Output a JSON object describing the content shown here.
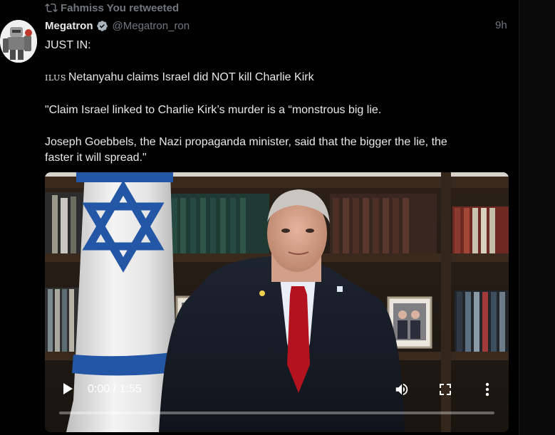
{
  "retweet": {
    "icon": "retweet-icon",
    "text": "Fahmiss You retweeted"
  },
  "author": {
    "display_name": "Megatron",
    "verified": true,
    "handle": "@Megatron_ron",
    "avatar": "robot-avatar"
  },
  "timestamp": "9h",
  "tweet": {
    "line1": "JUST IN:",
    "line2_flag": "ILUS",
    "line2_text": "Netanyahu claims Israel did NOT kill Charlie Kirk",
    "line3": "\"Claim Israel linked to Charlie Kirk’s murder is a “monstrous big lie.",
    "line4": "Joseph Goebbels, the Nazi propaganda minister, said that the bigger the lie, the",
    "line5": "faster it will spread.\""
  },
  "video": {
    "time_display": "0:00 / 1:55",
    "progress": 0.0,
    "controls": {
      "play": "play-icon",
      "volume": "volume-icon",
      "fullscreen": "fullscreen-icon",
      "more": "more-vertical-icon"
    }
  },
  "colors": {
    "background": "#000000",
    "text": "#e7e9ea",
    "muted": "#71767b",
    "verified": "#1d9bf0",
    "flag_blue": "#2456a6",
    "tie_red": "#b3121f"
  }
}
